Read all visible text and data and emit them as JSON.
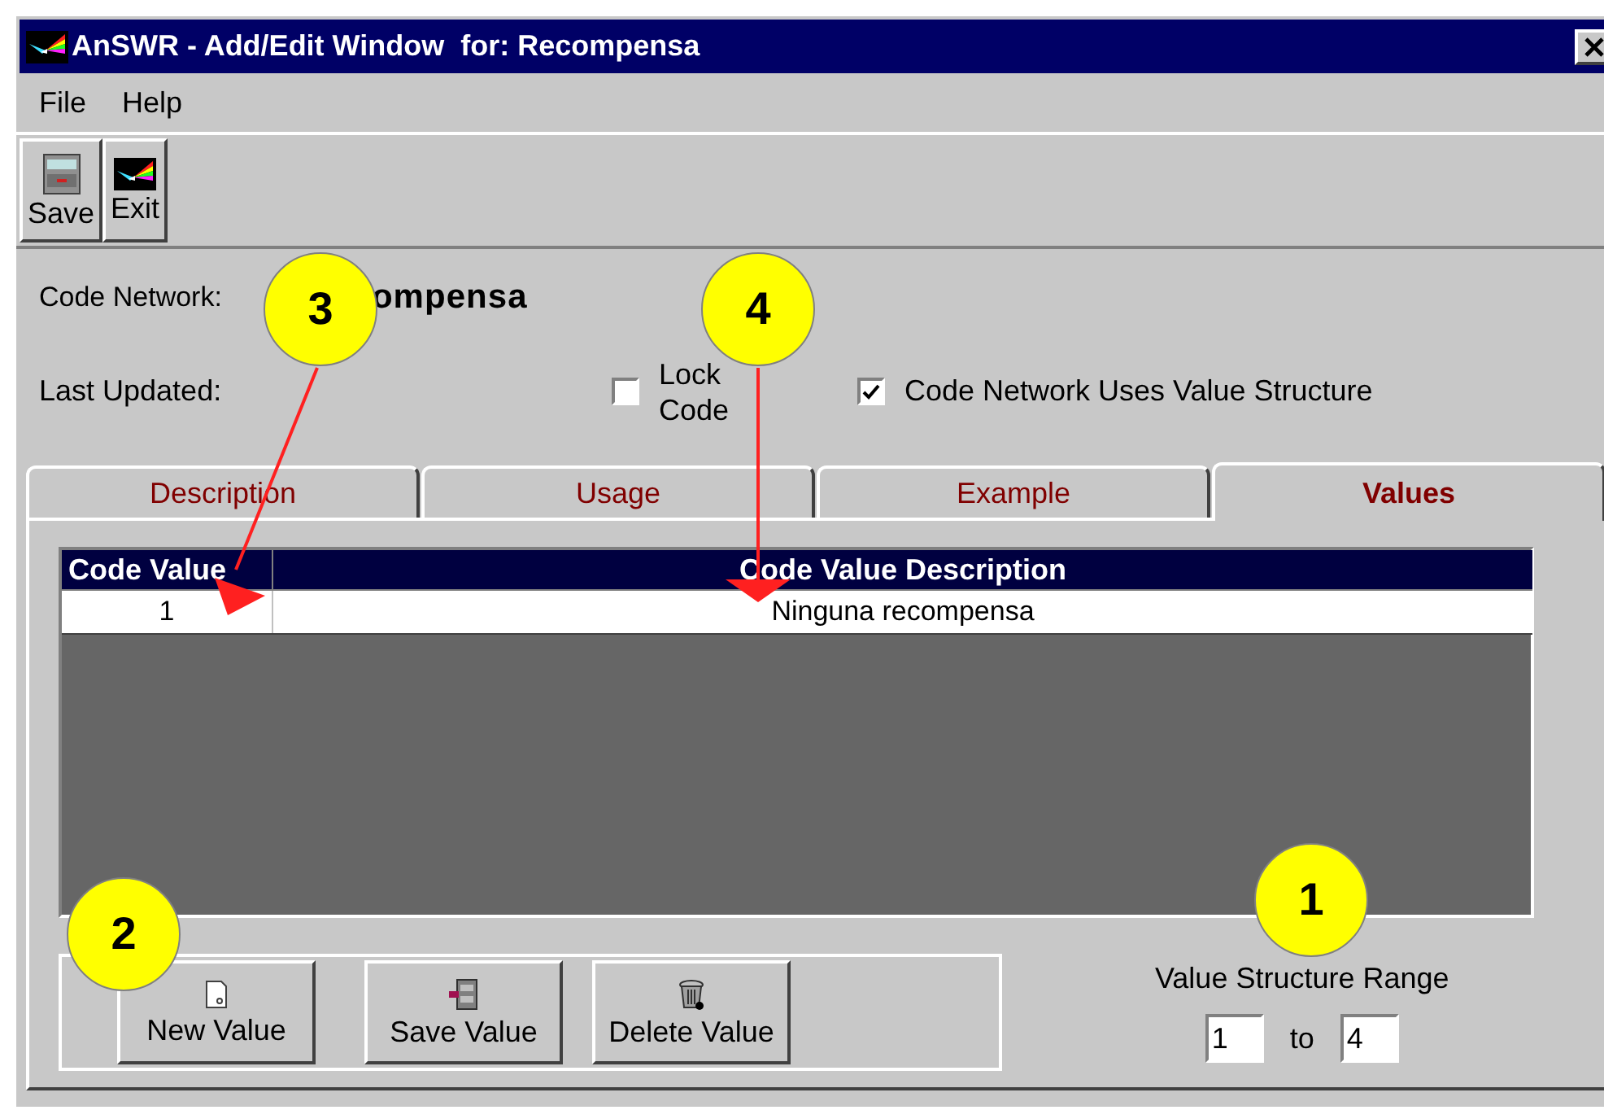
{
  "window": {
    "title": "AnSWR - Add/Edit Window  for: Recompensa"
  },
  "menu": [
    "File",
    "Help"
  ],
  "toolbar": [
    {
      "label": "Save",
      "kind": "save"
    },
    {
      "label": "Exit",
      "kind": "exit"
    }
  ],
  "code_network": {
    "label": "Code Network:",
    "value": "ompensa"
  },
  "last_updated": {
    "label": "Last Updated:"
  },
  "lock_code": {
    "label": "Lock Code",
    "checked": false
  },
  "uses_value_structure": {
    "label": "Code Network Uses Value Structure",
    "checked": true
  },
  "tabs": [
    {
      "label": "Description",
      "selected": false
    },
    {
      "label": "Usage",
      "selected": false
    },
    {
      "label": "Example",
      "selected": false
    },
    {
      "label": "Values",
      "selected": true
    }
  ],
  "table": {
    "columns": [
      "Code Value",
      "Code Value Description"
    ],
    "rows": [
      [
        "1",
        "Ninguna recompensa"
      ]
    ]
  },
  "buttons": [
    {
      "label": "New Value",
      "kind": "new"
    },
    {
      "label": "Save Value",
      "kind": "save"
    },
    {
      "label": "Delete Value",
      "kind": "delete"
    }
  ],
  "range": {
    "label": "Value Structure Range",
    "from": "1",
    "to_label": "to",
    "to": "4"
  },
  "callouts": [
    {
      "number": "3",
      "kind": "arrow_left"
    },
    {
      "number": "4",
      "kind": "arrow_down"
    },
    {
      "number": "2",
      "kind": "plain"
    },
    {
      "number": "1",
      "kind": "plain"
    }
  ]
}
